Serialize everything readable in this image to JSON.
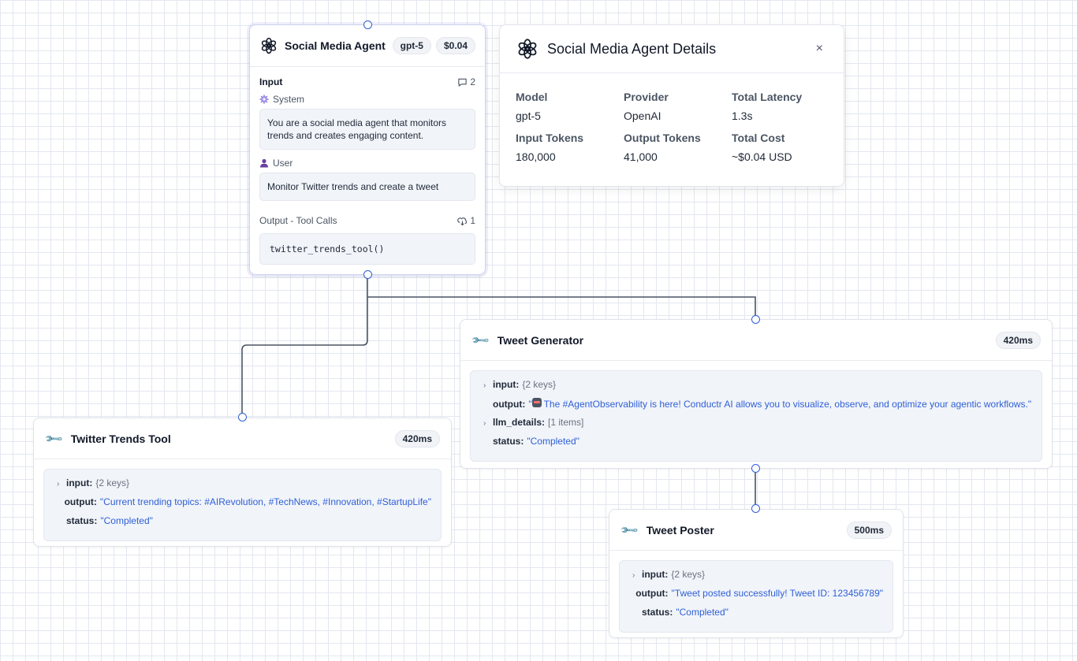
{
  "agent": {
    "title": "Social Media Agent",
    "model_pill": "gpt-5",
    "cost_pill": "$0.04",
    "input_label": "Input",
    "message_count": "2",
    "system_role": "System",
    "system_message": "You are a social media agent that monitors trends and creates engaging content.",
    "user_role": "User",
    "user_message": "Monitor Twitter trends and create a tweet",
    "output_label": "Output - Tool Calls",
    "tool_call_count": "1",
    "tool_call": "twitter_trends_tool()"
  },
  "details": {
    "title": "Social Media Agent Details",
    "close": "×",
    "fields": [
      {
        "label": "Model",
        "value": "gpt-5"
      },
      {
        "label": "Provider",
        "value": "OpenAI"
      },
      {
        "label": "Total Latency",
        "value": "1.3s"
      },
      {
        "label": "Input Tokens",
        "value": "180,000"
      },
      {
        "label": "Output Tokens",
        "value": "41,000"
      },
      {
        "label": "Total Cost",
        "value": "~$0.04 USD"
      }
    ]
  },
  "twitter_tool": {
    "title": "Twitter Trends Tool",
    "latency": "420ms",
    "input_key": "input:",
    "input_meta": "{2 keys}",
    "output_key": "output:",
    "output_value": "\"Current trending topics: #AIRevolution, #TechNews, #Innovation, #StartupLife\"",
    "status_key": "status:",
    "status_value": "\"Completed\""
  },
  "tweet_generator": {
    "title": "Tweet Generator",
    "latency": "420ms",
    "input_key": "input:",
    "input_meta": "{2 keys}",
    "output_key": "output:",
    "output_open_quote": "\"",
    "output_value": "The #AgentObservability is here! Conductr AI allows you to visualize, observe, and optimize your agentic workflows.\"",
    "llm_key": "llm_details:",
    "llm_meta": "[1 items]",
    "status_key": "status:",
    "status_value": "\"Completed\""
  },
  "tweet_poster": {
    "title": "Tweet Poster",
    "latency": "500ms",
    "input_key": "input:",
    "input_meta": "{2 keys}",
    "output_key": "output:",
    "output_value": "\"Tweet posted successfully! Tweet ID: 123456789\"",
    "status_key": "status:",
    "status_value": "\"Completed\""
  },
  "colors": {
    "edge": "#4b5563",
    "handle": "#2f5fd6",
    "string_value": "#2f5fd6"
  }
}
